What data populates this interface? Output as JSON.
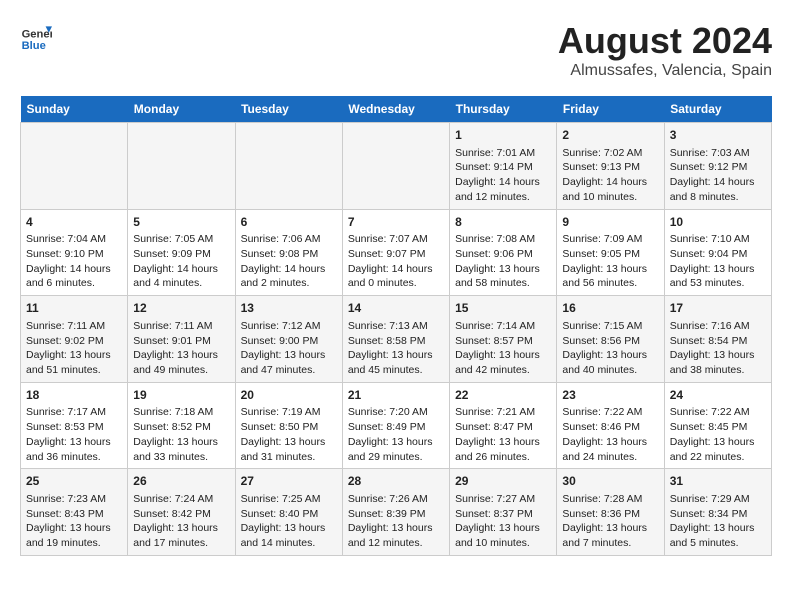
{
  "header": {
    "logo_general": "General",
    "logo_blue": "Blue",
    "main_title": "August 2024",
    "subtitle": "Almussafes, Valencia, Spain"
  },
  "calendar": {
    "days_of_week": [
      "Sunday",
      "Monday",
      "Tuesday",
      "Wednesday",
      "Thursday",
      "Friday",
      "Saturday"
    ],
    "weeks": [
      [
        {
          "day": "",
          "info": ""
        },
        {
          "day": "",
          "info": ""
        },
        {
          "day": "",
          "info": ""
        },
        {
          "day": "",
          "info": ""
        },
        {
          "day": "1",
          "info": "Sunrise: 7:01 AM\nSunset: 9:14 PM\nDaylight: 14 hours\nand 12 minutes."
        },
        {
          "day": "2",
          "info": "Sunrise: 7:02 AM\nSunset: 9:13 PM\nDaylight: 14 hours\nand 10 minutes."
        },
        {
          "day": "3",
          "info": "Sunrise: 7:03 AM\nSunset: 9:12 PM\nDaylight: 14 hours\nand 8 minutes."
        }
      ],
      [
        {
          "day": "4",
          "info": "Sunrise: 7:04 AM\nSunset: 9:10 PM\nDaylight: 14 hours\nand 6 minutes."
        },
        {
          "day": "5",
          "info": "Sunrise: 7:05 AM\nSunset: 9:09 PM\nDaylight: 14 hours\nand 4 minutes."
        },
        {
          "day": "6",
          "info": "Sunrise: 7:06 AM\nSunset: 9:08 PM\nDaylight: 14 hours\nand 2 minutes."
        },
        {
          "day": "7",
          "info": "Sunrise: 7:07 AM\nSunset: 9:07 PM\nDaylight: 14 hours\nand 0 minutes."
        },
        {
          "day": "8",
          "info": "Sunrise: 7:08 AM\nSunset: 9:06 PM\nDaylight: 13 hours\nand 58 minutes."
        },
        {
          "day": "9",
          "info": "Sunrise: 7:09 AM\nSunset: 9:05 PM\nDaylight: 13 hours\nand 56 minutes."
        },
        {
          "day": "10",
          "info": "Sunrise: 7:10 AM\nSunset: 9:04 PM\nDaylight: 13 hours\nand 53 minutes."
        }
      ],
      [
        {
          "day": "11",
          "info": "Sunrise: 7:11 AM\nSunset: 9:02 PM\nDaylight: 13 hours\nand 51 minutes."
        },
        {
          "day": "12",
          "info": "Sunrise: 7:11 AM\nSunset: 9:01 PM\nDaylight: 13 hours\nand 49 minutes."
        },
        {
          "day": "13",
          "info": "Sunrise: 7:12 AM\nSunset: 9:00 PM\nDaylight: 13 hours\nand 47 minutes."
        },
        {
          "day": "14",
          "info": "Sunrise: 7:13 AM\nSunset: 8:58 PM\nDaylight: 13 hours\nand 45 minutes."
        },
        {
          "day": "15",
          "info": "Sunrise: 7:14 AM\nSunset: 8:57 PM\nDaylight: 13 hours\nand 42 minutes."
        },
        {
          "day": "16",
          "info": "Sunrise: 7:15 AM\nSunset: 8:56 PM\nDaylight: 13 hours\nand 40 minutes."
        },
        {
          "day": "17",
          "info": "Sunrise: 7:16 AM\nSunset: 8:54 PM\nDaylight: 13 hours\nand 38 minutes."
        }
      ],
      [
        {
          "day": "18",
          "info": "Sunrise: 7:17 AM\nSunset: 8:53 PM\nDaylight: 13 hours\nand 36 minutes."
        },
        {
          "day": "19",
          "info": "Sunrise: 7:18 AM\nSunset: 8:52 PM\nDaylight: 13 hours\nand 33 minutes."
        },
        {
          "day": "20",
          "info": "Sunrise: 7:19 AM\nSunset: 8:50 PM\nDaylight: 13 hours\nand 31 minutes."
        },
        {
          "day": "21",
          "info": "Sunrise: 7:20 AM\nSunset: 8:49 PM\nDaylight: 13 hours\nand 29 minutes."
        },
        {
          "day": "22",
          "info": "Sunrise: 7:21 AM\nSunset: 8:47 PM\nDaylight: 13 hours\nand 26 minutes."
        },
        {
          "day": "23",
          "info": "Sunrise: 7:22 AM\nSunset: 8:46 PM\nDaylight: 13 hours\nand 24 minutes."
        },
        {
          "day": "24",
          "info": "Sunrise: 7:22 AM\nSunset: 8:45 PM\nDaylight: 13 hours\nand 22 minutes."
        }
      ],
      [
        {
          "day": "25",
          "info": "Sunrise: 7:23 AM\nSunset: 8:43 PM\nDaylight: 13 hours\nand 19 minutes."
        },
        {
          "day": "26",
          "info": "Sunrise: 7:24 AM\nSunset: 8:42 PM\nDaylight: 13 hours\nand 17 minutes."
        },
        {
          "day": "27",
          "info": "Sunrise: 7:25 AM\nSunset: 8:40 PM\nDaylight: 13 hours\nand 14 minutes."
        },
        {
          "day": "28",
          "info": "Sunrise: 7:26 AM\nSunset: 8:39 PM\nDaylight: 13 hours\nand 12 minutes."
        },
        {
          "day": "29",
          "info": "Sunrise: 7:27 AM\nSunset: 8:37 PM\nDaylight: 13 hours\nand 10 minutes."
        },
        {
          "day": "30",
          "info": "Sunrise: 7:28 AM\nSunset: 8:36 PM\nDaylight: 13 hours\nand 7 minutes."
        },
        {
          "day": "31",
          "info": "Sunrise: 7:29 AM\nSunset: 8:34 PM\nDaylight: 13 hours\nand 5 minutes."
        }
      ]
    ]
  }
}
